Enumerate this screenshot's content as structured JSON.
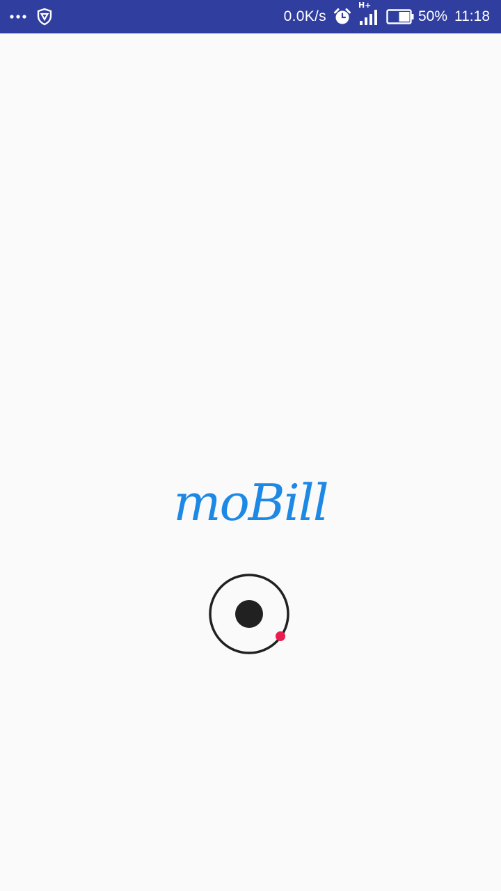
{
  "status_bar": {
    "network_speed": "0.0K/s",
    "network_type": "H+",
    "battery_percent": "50%",
    "battery_level": 0.5,
    "time": "11:18",
    "colors": {
      "background": "#303f9f",
      "foreground": "#ffffff"
    },
    "icons": [
      "more-icon",
      "vpn-shield-icon",
      "alarm-icon",
      "signal-icon",
      "battery-icon"
    ]
  },
  "splash": {
    "app_name": "moBill",
    "colors": {
      "logo": "#1e88e5",
      "loader_ring": "#212121",
      "loader_dot": "#e91e4f",
      "background": "#fafafa"
    }
  }
}
